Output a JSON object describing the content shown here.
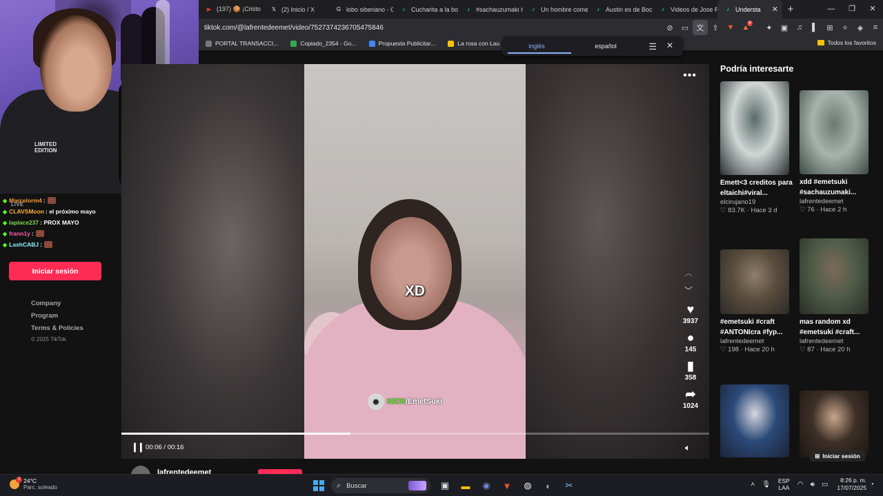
{
  "tabs": [
    {
      "label": "(197) 🍪 ¡Cristo",
      "fav_color": "#e53935",
      "glyph": "▶"
    },
    {
      "label": "(2) Inicio / X",
      "fav_color": "#ffffff",
      "glyph": "𝕏"
    },
    {
      "label": "lobo siberiano - G",
      "fav_color": "#ffffff",
      "glyph": "G"
    },
    {
      "label": "Cucharita a la boc",
      "fav_color": "#25f4ee",
      "glyph": "♪"
    },
    {
      "label": "#sachauzumaki #",
      "fav_color": "#25f4ee",
      "glyph": "♪"
    },
    {
      "label": "Un hombre come",
      "fav_color": "#25f4ee",
      "glyph": "♪"
    },
    {
      "label": "Austin es de Boca",
      "fav_color": "#25f4ee",
      "glyph": "♪"
    },
    {
      "label": "Videos de Jose R",
      "fav_color": "#25f4ee",
      "glyph": "♪"
    },
    {
      "label": "Understa",
      "fav_color": "#25f4ee",
      "glyph": "♪",
      "active": true
    }
  ],
  "address": {
    "url": "tiktok.com/@lafrentedeemet/video/7527374236705475846"
  },
  "bookmarks": {
    "items": [
      {
        "label": "PORTAL TRANSACCI...",
        "color": "#7a7a7a"
      },
      {
        "label": "Copiado_2354 - Go...",
        "color": "#34a853"
      },
      {
        "label": "Propuesta Publicitar...",
        "color": "#4285f4"
      },
      {
        "label": "La rosa con Lau",
        "color": "#f4c20d"
      }
    ],
    "all_label": "Todos los favoritos"
  },
  "translate": {
    "source": "inglés",
    "target": "español"
  },
  "webcam": {
    "shirt_text_1": "LIMITED",
    "shirt_text_2": "EDITION"
  },
  "chat": {
    "live_label": "LIVE",
    "lines": [
      {
        "user": "Marcelorm4",
        "color": "#ff9b2f",
        "msg": "",
        "emote": true
      },
      {
        "user": "CLAVSMoon",
        "color": "#ffb13b",
        "msg": ": el próximo mayo",
        "emote": false
      },
      {
        "user": "laplace237",
        "color": "#7ed957",
        "msg": ": PROX MAYO",
        "emote": false
      },
      {
        "user": "frann1y",
        "color": "#ff5fb2",
        "msg": "",
        "emote": true
      },
      {
        "user": "LashCABJ",
        "color": "#8ef0ff",
        "msg": "",
        "emote": true
      }
    ]
  },
  "sidebar": {
    "login_label": "Iniciar sesión",
    "footer": [
      "Company",
      "Program",
      "Terms & Policies"
    ],
    "copyright": "© 2025 TikTok"
  },
  "video": {
    "caption_overlay": "XD",
    "watermark_a": "KICK",
    "watermark_b": "/EmetSuki",
    "more_icon": "•••",
    "likes": "3937",
    "comments": "145",
    "saves": "358",
    "shares": "1024",
    "time": "00:06 / 00:16",
    "progress": 0.39,
    "author": "lafrentedeemet"
  },
  "recommended": {
    "title": "Podría interesarte",
    "login_label": "Iniciar sesión",
    "items": [
      {
        "caption": "Emett<3 creditos para eltaichi#viral...",
        "author": "elcirujano19",
        "likes": "83.7K",
        "when": "Hace 3 d",
        "palette": [
          "#cfd6d3",
          "#5a6b6a",
          "#2a2f33"
        ]
      },
      {
        "caption": "xdd #emetsuki #sachauzumaki...",
        "author": "lafrentedeemet",
        "likes": "76",
        "when": "Hace 2 h",
        "palette": [
          "#a8b3ad",
          "#6b7a72",
          "#3d4a44"
        ]
      },
      {
        "caption": "#emetsuki #craft #ANTONIcra #fyp...",
        "author": "lafrentedeemet",
        "likes": "198",
        "when": "Hace 20 h",
        "palette": [
          "#5a4d3d",
          "#8f7f6c",
          "#2c2a28"
        ]
      },
      {
        "caption": "mas random xd #emetsuki #craft...",
        "author": "lafrentedeemet",
        "likes": "87",
        "when": "Hace 20 h",
        "palette": [
          "#4f5c48",
          "#7d6a58",
          "#2a2d28"
        ]
      },
      {
        "caption": "",
        "author": "",
        "likes": "",
        "when": "",
        "palette": [
          "#2b4a78",
          "#d6d6e0",
          "#1c2238"
        ]
      },
      {
        "caption": "",
        "author": "",
        "likes": "",
        "when": "",
        "palette": [
          "#3d3027",
          "#c9a58c",
          "#1a1512"
        ]
      }
    ]
  },
  "taskbar": {
    "weather_temp": "24°C",
    "weather_desc": "Parc. soleado",
    "weather_badge": "3",
    "search_placeholder": "Buscar",
    "lang_1": "ESP",
    "lang_2": "LAA",
    "time": "8:26 p. m.",
    "date": "17/07/2025"
  }
}
